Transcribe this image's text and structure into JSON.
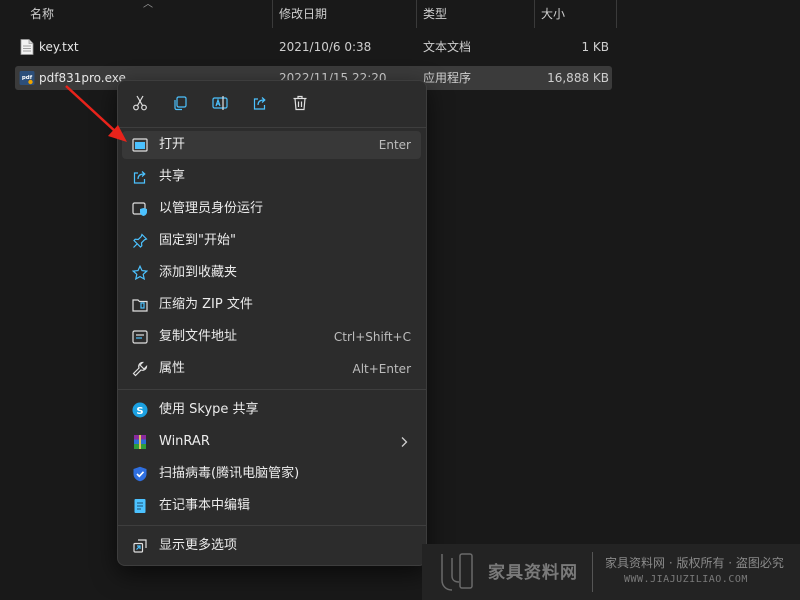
{
  "columns": {
    "name": "名称",
    "date": "修改日期",
    "type": "类型",
    "size": "大小"
  },
  "files": [
    {
      "name": "key.txt",
      "date": "2021/10/6 0:38",
      "type": "文本文档",
      "size": "1 KB",
      "icon": "text-file-icon"
    },
    {
      "name": "pdf831pro.exe",
      "date": "2022/11/15 22:20",
      "type": "应用程序",
      "size": "16,888 KB",
      "icon": "pdf-app-icon",
      "selected": true
    }
  ],
  "menu": {
    "toolbar": [
      "cut-icon",
      "copy-icon",
      "rename-icon",
      "share-icon",
      "delete-icon"
    ],
    "items": [
      {
        "label": "打开",
        "shortcut": "Enter",
        "icon": "open-window-icon"
      },
      {
        "label": "共享",
        "shortcut": "",
        "icon": "share-icon"
      },
      {
        "label": "以管理员身份运行",
        "shortcut": "",
        "icon": "shield-admin-icon"
      },
      {
        "label": "固定到\"开始\"",
        "shortcut": "",
        "icon": "pin-icon"
      },
      {
        "label": "添加到收藏夹",
        "shortcut": "",
        "icon": "star-icon"
      },
      {
        "label": "压缩为 ZIP 文件",
        "shortcut": "",
        "icon": "zip-folder-icon"
      },
      {
        "label": "复制文件地址",
        "shortcut": "Ctrl+Shift+C",
        "icon": "copy-path-icon"
      },
      {
        "label": "属性",
        "shortcut": "Alt+Enter",
        "icon": "wrench-icon"
      },
      {
        "label": "使用 Skype 共享",
        "shortcut": "",
        "icon": "skype-icon"
      },
      {
        "label": "WinRAR",
        "shortcut": "",
        "icon": "winrar-icon"
      },
      {
        "label": "扫描病毒(腾讯电脑管家)",
        "shortcut": "",
        "icon": "tencent-shield-icon"
      },
      {
        "label": "在记事本中编辑",
        "shortcut": "",
        "icon": "notepad-icon"
      },
      {
        "label": "显示更多选项",
        "shortcut": "",
        "icon": "show-more-icon"
      }
    ]
  },
  "watermark": {
    "main": "家具资料网",
    "rights": "家具资料网 · 版权所有 · 盗图必究",
    "url": "WWW.JIAJUZILIAO.COM"
  },
  "colors": {
    "background": "#191919",
    "menu": "#2c2c2c",
    "accent": "#4cc2ff",
    "arrow": "#e8231b"
  }
}
